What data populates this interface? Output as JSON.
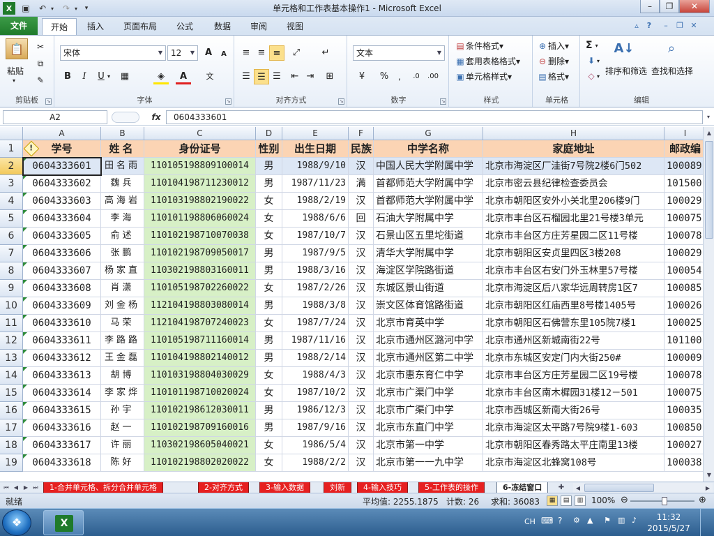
{
  "window": {
    "title": "单元格和工作表基本操作1 - Microsoft Excel"
  },
  "ribbon_tabs": [
    "文件",
    "开始",
    "插入",
    "页面布局",
    "公式",
    "数据",
    "审阅",
    "视图"
  ],
  "ribbon": {
    "clipboard": {
      "paste": "粘贴",
      "label": "剪贴板"
    },
    "font": {
      "name": "宋体",
      "size": "12",
      "bold": "B",
      "italic": "I",
      "underline": "U",
      "label": "字体",
      "grow": "A",
      "shrink": "A",
      "font_color": "A"
    },
    "alignment": {
      "label": "对齐方式"
    },
    "number": {
      "format": "文本",
      "label": "数字",
      "percent": "%"
    },
    "styles": {
      "conditional": "条件格式",
      "table": "套用表格格式",
      "cell_styles": "单元格样式",
      "label": "样式"
    },
    "cells": {
      "insert": "插入",
      "delete": "删除",
      "format": "格式",
      "label": "单元格"
    },
    "editing": {
      "sort": "排序和筛选",
      "find": "查找和选择",
      "label": "编辑",
      "sum": "Σ"
    }
  },
  "formula_bar": {
    "name_box": "A2",
    "fx": "fx",
    "value": "0604333601"
  },
  "columns": [
    "A",
    "B",
    "C",
    "D",
    "E",
    "F",
    "G",
    "H",
    "I"
  ],
  "header_row": {
    "num": "1",
    "cells": [
      "学号",
      "姓名",
      "身份证号",
      "性别",
      "出生日期",
      "民族",
      "中学名称",
      "家庭地址",
      "邮政编"
    ]
  },
  "rows": [
    {
      "num": "2",
      "cells": [
        "0604333601",
        "田名雨",
        "110105198809100014",
        "男",
        "1988/9/10",
        "汉",
        "中国人民大学附属中学",
        "北京市海淀区厂洼街7号院2楼6门502",
        "100089"
      ]
    },
    {
      "num": "3",
      "cells": [
        "0604333602",
        "魏兵",
        "110104198711230012",
        "男",
        "1987/11/23",
        "满",
        "首都师范大学附属中学",
        "北京市密云县纪律检查委员会",
        "101500"
      ]
    },
    {
      "num": "4",
      "cells": [
        "0604333603",
        "高海岩",
        "110103198802190022",
        "女",
        "1988/2/19",
        "汉",
        "首都师范大学附属中学",
        "北京市朝阳区安外小关北里206楼9门",
        "100029"
      ]
    },
    {
      "num": "5",
      "cells": [
        "0604333604",
        "李海",
        "110101198806060024",
        "女",
        "1988/6/6",
        "回",
        "石油大学附属中学",
        "北京市丰台区石榴园北里21号楼3单元",
        "100075"
      ]
    },
    {
      "num": "6",
      "cells": [
        "0604333605",
        "俞述",
        "110102198710070038",
        "女",
        "1987/10/7",
        "汉",
        "石景山区五里坨街道",
        "北京市丰台区方庄芳星园二区11号楼",
        "100078"
      ]
    },
    {
      "num": "7",
      "cells": [
        "0604333606",
        "张鹏",
        "110102198709050017",
        "男",
        "1987/9/5",
        "汉",
        "清华大学附属中学",
        "北京市朝阳区安贞里四区3楼208",
        "100029"
      ]
    },
    {
      "num": "8",
      "cells": [
        "0604333607",
        "杨家直",
        "110302198803160011",
        "男",
        "1988/3/16",
        "汉",
        "海淀区学院路街道",
        "北京市丰台区右安门外玉林里57号楼",
        "100054"
      ]
    },
    {
      "num": "9",
      "cells": [
        "0604333608",
        "肖潇",
        "110105198702260022",
        "女",
        "1987/2/26",
        "汉",
        "东城区景山街道",
        "北京市海淀区后八家华远周转房1区7",
        "100085"
      ]
    },
    {
      "num": "10",
      "cells": [
        "0604333609",
        "刘金杨",
        "112104198803080014",
        "男",
        "1988/3/8",
        "汉",
        "崇文区体育馆路街道",
        "北京市朝阳区红庙西里8号楼1405号",
        "100026"
      ]
    },
    {
      "num": "11",
      "cells": [
        "0604333610",
        "马荣",
        "112104198707240023",
        "女",
        "1987/7/24",
        "汉",
        "北京市育英中学",
        "北京市朝阳区石佛营东里105院7楼1",
        "100025"
      ]
    },
    {
      "num": "12",
      "cells": [
        "0604333611",
        "李路路",
        "110105198711160014",
        "男",
        "1987/11/16",
        "汉",
        "北京市通州区潞河中学",
        "北京市通州区新城南街22号",
        "101100"
      ]
    },
    {
      "num": "13",
      "cells": [
        "0604333612",
        "王金磊",
        "110104198802140012",
        "男",
        "1988/2/14",
        "汉",
        "北京市通州区第二中学",
        "北京市东城区安定门内大街250#",
        "100009"
      ]
    },
    {
      "num": "14",
      "cells": [
        "0604333613",
        "胡博",
        "110103198804030029",
        "女",
        "1988/4/3",
        "汉",
        "北京市惠东育仁中学",
        "北京市丰台区方庄芳星园二区19号楼",
        "100078"
      ]
    },
    {
      "num": "15",
      "cells": [
        "0604333614",
        "李家烨",
        "110101198710020024",
        "女",
        "1987/10/2",
        "汉",
        "北京市广渠门中学",
        "北京市丰台区南木樨园31楼12－501",
        "100075"
      ]
    },
    {
      "num": "16",
      "cells": [
        "0604333615",
        "孙宇",
        "110102198612030011",
        "男",
        "1986/12/3",
        "汉",
        "北京市广渠门中学",
        "北京市西城区新南大街26号",
        "100035"
      ]
    },
    {
      "num": "17",
      "cells": [
        "0604333616",
        "赵一",
        "110102198709160016",
        "男",
        "1987/9/16",
        "汉",
        "北京市东直门中学",
        "北京市海淀区太平路7号院9楼1-603",
        "100850"
      ]
    },
    {
      "num": "18",
      "cells": [
        "0604333617",
        "许丽",
        "110302198605040021",
        "女",
        "1986/5/4",
        "汉",
        "北京市第一中学",
        "北京市朝阳区春秀路太平庄南里13楼",
        "100027"
      ]
    },
    {
      "num": "19",
      "cells": [
        "0604333618",
        "陈好",
        "110102198802020022",
        "女",
        "1988/2/2",
        "汉",
        "北京市第一一九中学",
        "北京市海淀区北蜂窝108号",
        "100038"
      ]
    }
  ],
  "sheet_tabs": [
    "1-合并单元格、拆分合并单元格",
    "2-对齐方式",
    "3-输入数据",
    "刘新",
    "4-输入技巧",
    "5-工作表的操作",
    "6-冻结窗口"
  ],
  "status": {
    "mode": "就绪",
    "average": "平均值: 2255.1875",
    "count": "计数: 26",
    "sum": "求和: 36083",
    "zoom": "100%"
  },
  "taskbar": {
    "lang": "CH",
    "time": "11:32",
    "date": "2015/5/27"
  },
  "colors": {
    "header_fill": "#fbd4b4",
    "id_fill": "#d7f0c6",
    "sheet_tab": "#e62020",
    "file_tab": "#1f7a2b"
  }
}
